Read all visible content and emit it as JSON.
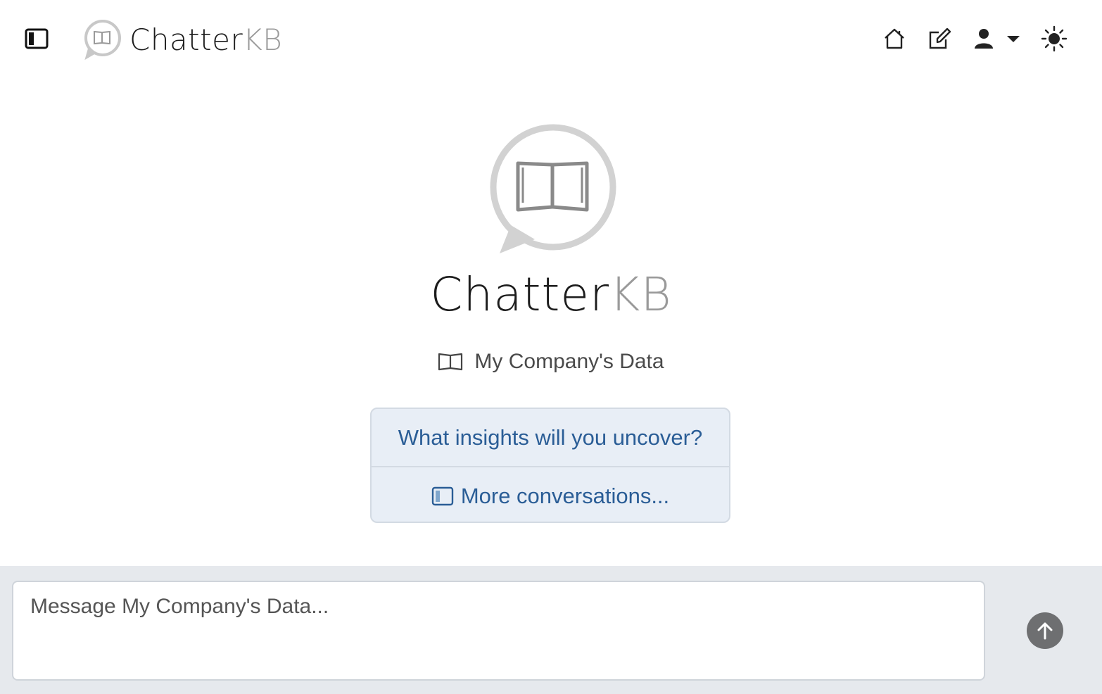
{
  "header": {
    "brand_main": "Chatter",
    "brand_accent": "KB",
    "icons": [
      "sidebar-toggle-icon",
      "logo-icon",
      "home-icon",
      "edit-icon",
      "user-icon",
      "chevron-down-icon",
      "sun-icon"
    ]
  },
  "hero": {
    "title_main": "Chatter",
    "title_accent": "KB",
    "knowledge_base": "My Company's Data"
  },
  "card": {
    "prompt": "What insights will you uncover?",
    "more_conversations": "More conversations..."
  },
  "composer": {
    "placeholder": "Message My Company's Data..."
  },
  "colors": {
    "link": "#2a5d96",
    "card_bg": "#e8eef6",
    "composer_bg": "#e6e9ed",
    "send_button": "#6e6f71"
  }
}
